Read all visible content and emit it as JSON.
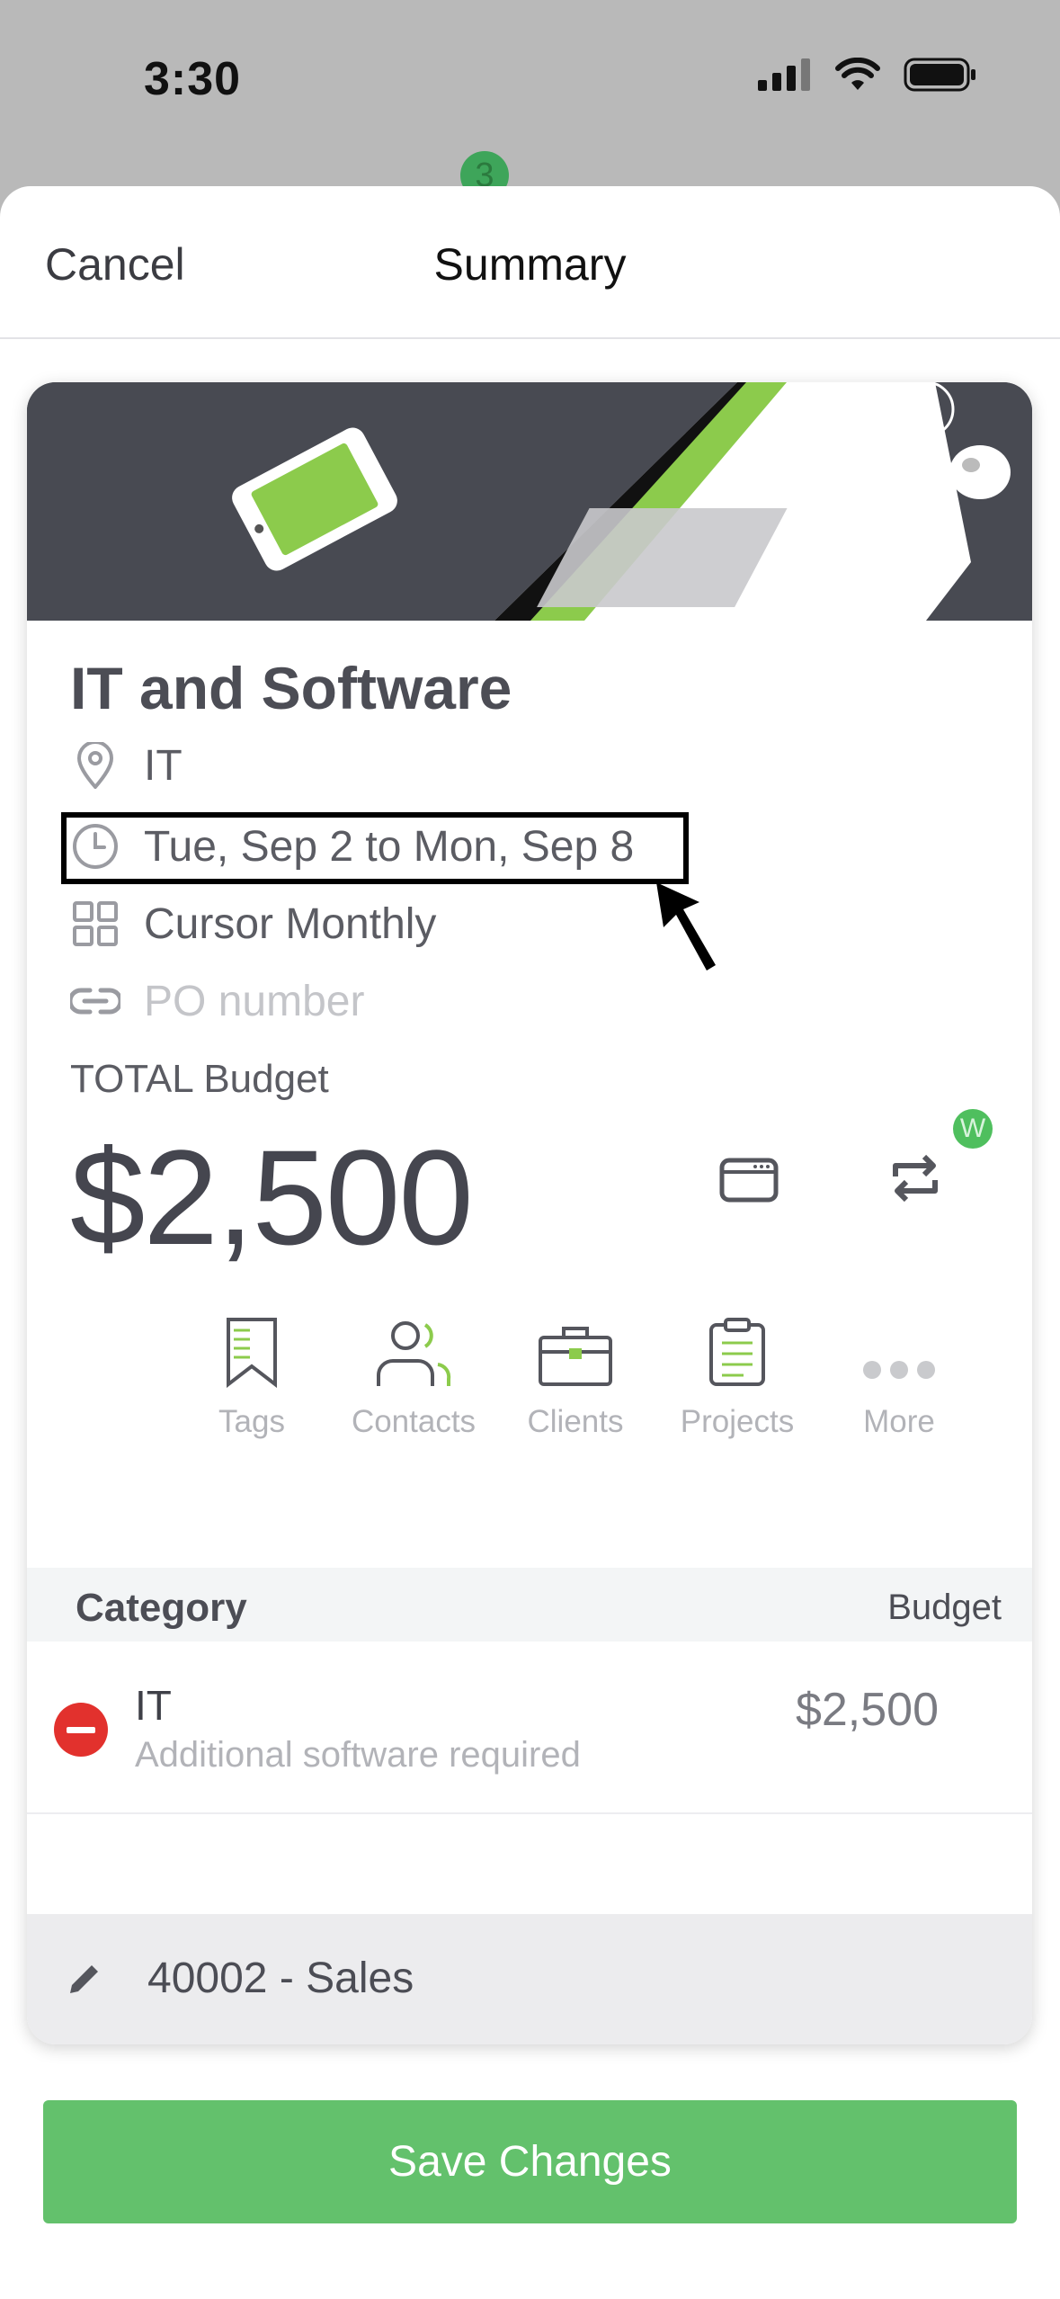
{
  "status_bar": {
    "time": "3:30"
  },
  "background": {
    "badge_count": "3"
  },
  "nav": {
    "cancel": "Cancel",
    "title": "Summary"
  },
  "item": {
    "title": "IT and Software",
    "location": "IT",
    "date_range": "Tue, Sep 2 to Mon, Sep 8",
    "frequency": "Cursor Monthly",
    "po_placeholder": "PO number",
    "total_label": "TOTAL Budget",
    "total_amount": "$2,500",
    "w_badge": "W"
  },
  "actions": [
    {
      "label": "Tags",
      "icon": "bookmark-icon"
    },
    {
      "label": "Contacts",
      "icon": "contacts-icon"
    },
    {
      "label": "Clients",
      "icon": "briefcase-icon"
    },
    {
      "label": "Projects",
      "icon": "clipboard-icon"
    },
    {
      "label": "More",
      "icon": "more-dots-icon"
    }
  ],
  "category_table": {
    "header_category": "Category",
    "header_budget": "Budget",
    "rows": [
      {
        "name": "IT",
        "description": "Additional software required",
        "amount": "$2,500"
      }
    ]
  },
  "account": {
    "label": "40002 - Sales"
  },
  "save_button": "Save Changes",
  "colors": {
    "accent_green": "#63c16c",
    "remove_red": "#e2312d",
    "hero_dark": "#484a52"
  }
}
